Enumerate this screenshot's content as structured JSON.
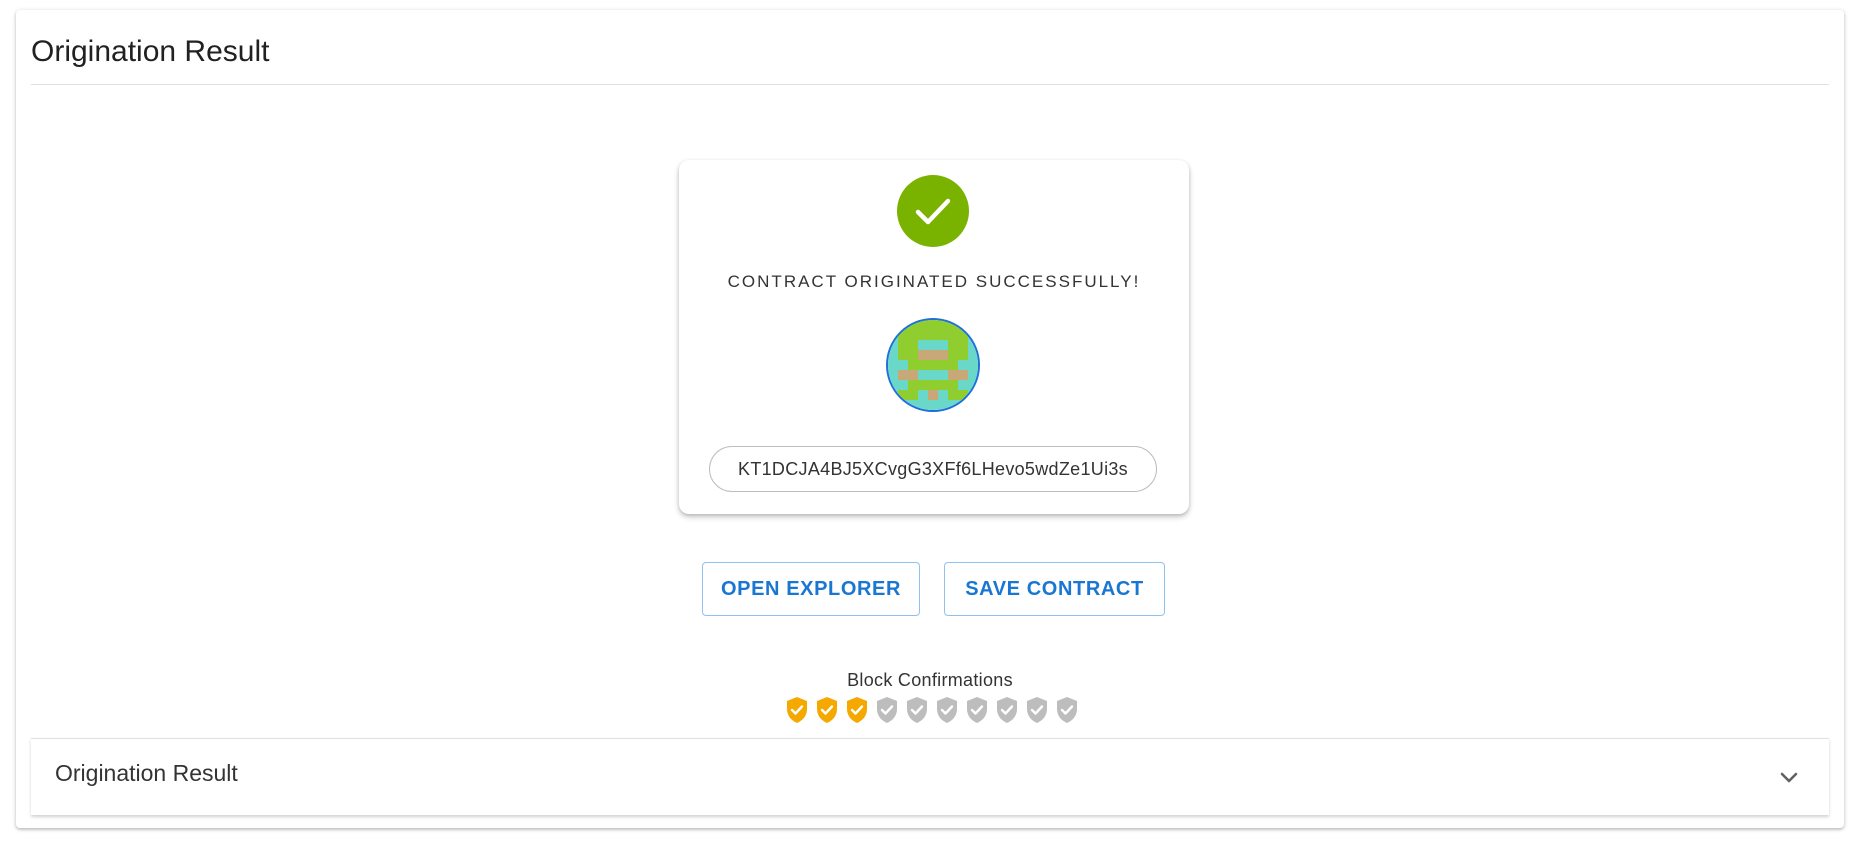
{
  "card": {
    "title": "Origination Result"
  },
  "result": {
    "status_icon": "check-circle-icon",
    "message": "CONTRACT ORIGINATED SUCCESSFULLY!",
    "avatar": "contract-identicon",
    "address": "KT1DCJA4BJ5XCvgG3XFf6LHevo5wdZe1Ui3s"
  },
  "actions": {
    "open_explorer": "OPEN EXPLORER",
    "save_contract": "SAVE CONTRACT"
  },
  "confirmations": {
    "label": "Block Confirmations",
    "confirmed": 3,
    "total": 10,
    "confirmed_icon": "shield-check-icon",
    "pending_icon": "shield-check-icon"
  },
  "accordion": {
    "title": "Origination Result",
    "expand_icon": "chevron-down-icon"
  },
  "colors": {
    "success": "#7ab200",
    "accent": "#1976d2",
    "confirmed_shield": "#f5a800",
    "pending_shield": "#bdbdbd"
  }
}
